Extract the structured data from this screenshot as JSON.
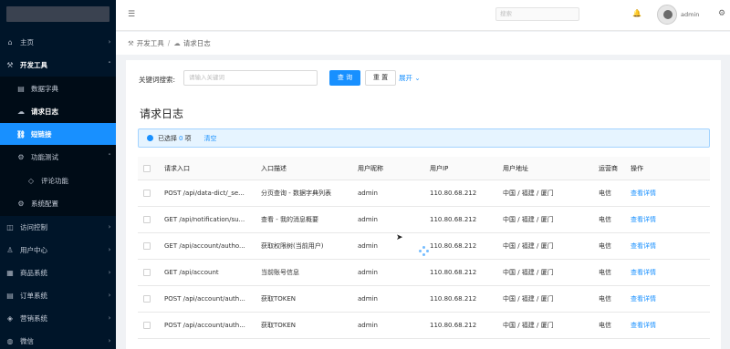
{
  "sidebar": {
    "items": [
      {
        "icon": "⌂",
        "label": "主页",
        "arrow": "›"
      },
      {
        "icon": "⚒",
        "label": "开发工具",
        "arrow": "˄"
      },
      {
        "icon": "▤",
        "label": "数据字典",
        "arrow": ""
      },
      {
        "icon": "☁",
        "label": "请求日志",
        "arrow": ""
      },
      {
        "icon": "⛓",
        "label": "短链接",
        "arrow": ""
      },
      {
        "icon": "⚙",
        "label": "功能测试",
        "arrow": "˄"
      },
      {
        "icon": "◇",
        "label": "评论功能",
        "arrow": ""
      },
      {
        "icon": "⚙",
        "label": "系统配置",
        "arrow": ""
      },
      {
        "icon": "◫",
        "label": "访问控制",
        "arrow": "›"
      },
      {
        "icon": "♙",
        "label": "用户中心",
        "arrow": "›"
      },
      {
        "icon": "▦",
        "label": "商品系统",
        "arrow": "›"
      },
      {
        "icon": "▤",
        "label": "订单系统",
        "arrow": "›"
      },
      {
        "icon": "◈",
        "label": "营销系统",
        "arrow": "›"
      },
      {
        "icon": "◍",
        "label": "微信",
        "arrow": "›"
      }
    ]
  },
  "header": {
    "menu_icon": "☰",
    "search_placeholder": "搜索",
    "bell_icon": "🔔",
    "username": "admin",
    "settings_icon": "⚙"
  },
  "breadcrumb": {
    "items": [
      "开发工具",
      "请求日志"
    ],
    "separator": "/"
  },
  "filter": {
    "label": "关键词搜索:",
    "placeholder": "请输入关键词",
    "query_button": "查 询",
    "reset_button": "重 置",
    "expand_label": "展开",
    "expand_icon": "⌄"
  },
  "page_title": "请求日志",
  "alert": {
    "prefix": "已选择",
    "count": "0",
    "suffix": "项",
    "clear": "清空"
  },
  "table": {
    "columns": [
      "请求入口",
      "入口描述",
      "用户昵称",
      "用户IP",
      "用户地址",
      "运营商",
      "操作"
    ],
    "rows": [
      {
        "entry": "POST /api/data-dict/_se...",
        "desc": "分页查询 - 数据字典列表",
        "user": "admin",
        "ip": "110.80.68.212",
        "addr": "中国 / 福建 / 厦门",
        "isp": "电信",
        "action": "查看详情"
      },
      {
        "entry": "GET /api/notification/su...",
        "desc": "查看 - 我的消息概要",
        "user": "admin",
        "ip": "110.80.68.212",
        "addr": "中国 / 福建 / 厦门",
        "isp": "电信",
        "action": "查看详情"
      },
      {
        "entry": "GET /api/account/autho...",
        "desc": "获取权限树(当前用户)",
        "user": "admin",
        "ip": "110.80.68.212",
        "addr": "中国 / 福建 / 厦门",
        "isp": "电信",
        "action": "查看详情"
      },
      {
        "entry": "GET /api/account",
        "desc": "当前账号信息",
        "user": "admin",
        "ip": "110.80.68.212",
        "addr": "中国 / 福建 / 厦门",
        "isp": "电信",
        "action": "查看详情"
      },
      {
        "entry": "POST /api/account/auth...",
        "desc": "获取TOKEN",
        "user": "admin",
        "ip": "110.80.68.212",
        "addr": "中国 / 福建 / 厦门",
        "isp": "电信",
        "action": "查看详情"
      },
      {
        "entry": "POST /api/account/auth...",
        "desc": "获取TOKEN",
        "user": "admin",
        "ip": "110.80.68.212",
        "addr": "中国 / 福建 / 厦门",
        "isp": "电信",
        "action": "查看详情"
      }
    ]
  },
  "colors": {
    "sidebar_bg": "#001529",
    "accent": "#1890ff"
  }
}
